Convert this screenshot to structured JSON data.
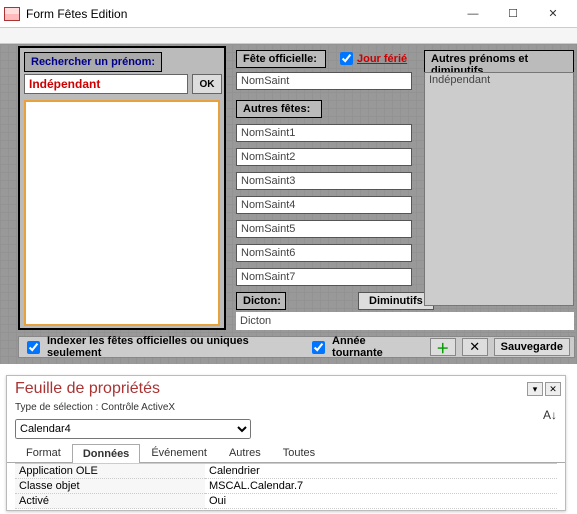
{
  "window": {
    "title": "Form Fêtes Edition"
  },
  "search": {
    "label": "Rechercher un prénom:",
    "value": "Indépendant",
    "ok": "OK"
  },
  "official": {
    "label": "Fête officielle:",
    "holiday_label": "Jour férié",
    "field": "NomSaint"
  },
  "autres_label": "Autres fêtes:",
  "slots": [
    "NomSaint1",
    "NomSaint2",
    "NomSaint3",
    "NomSaint4",
    "NomSaint5",
    "NomSaint6",
    "NomSaint7"
  ],
  "dicton": {
    "label": "Dicton:",
    "value": "Dicton",
    "diminutifs": "Diminutifs"
  },
  "rightcol": {
    "label": "Autres prénoms et diminutifs",
    "value": "Indépendant"
  },
  "footer": {
    "index": "Indexer les fêtes officielles ou uniques seulement",
    "annee": "Année tournante",
    "save": "Sauvegarde"
  },
  "props": {
    "title": "Feuille de propriétés",
    "subtitle": "Type de sélection :  Contrôle ActiveX",
    "combo": "Calendar4",
    "tabs": [
      "Format",
      "Données",
      "Événement",
      "Autres",
      "Toutes"
    ],
    "rows": [
      {
        "k": "Application OLE",
        "v": "Calendrier"
      },
      {
        "k": "Classe objet",
        "v": "MSCAL.Calendar.7"
      },
      {
        "k": "Activé",
        "v": "Oui"
      }
    ]
  }
}
